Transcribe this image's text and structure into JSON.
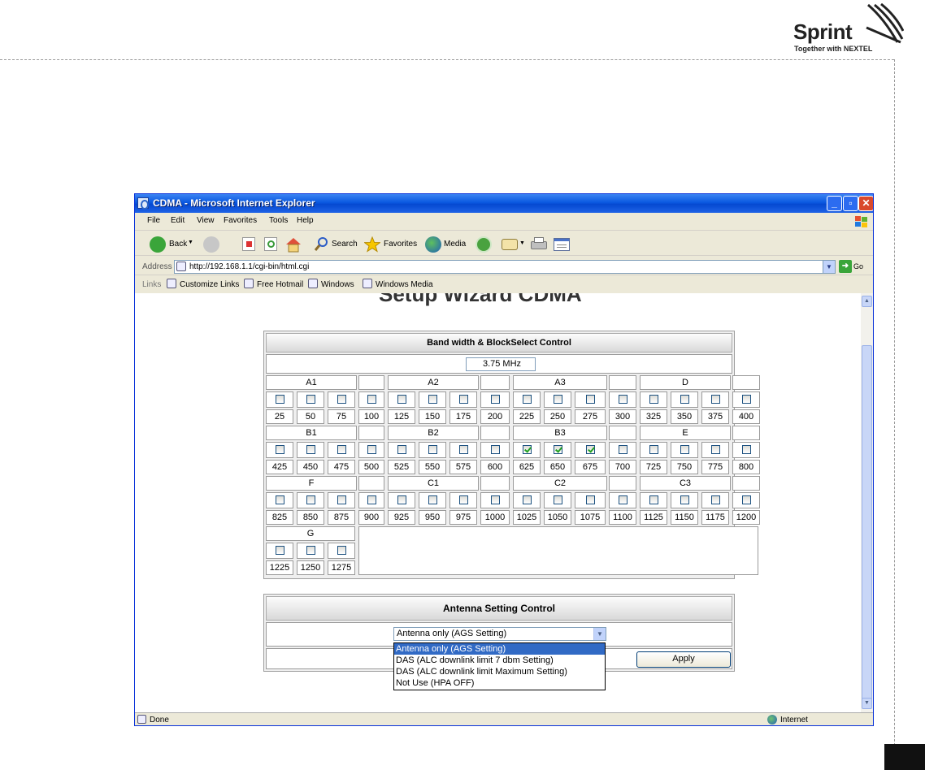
{
  "brand": {
    "name": "Sprint",
    "tagline": "Together with NEXTEL"
  },
  "window": {
    "title": "CDMA - Microsoft Internet Explorer"
  },
  "menu": [
    "File",
    "Edit",
    "View",
    "Favorites",
    "Tools",
    "Help"
  ],
  "toolbar": {
    "back": "Back",
    "search": "Search",
    "favorites": "Favorites",
    "media": "Media"
  },
  "address": {
    "label": "Address",
    "url": "http://192.168.1.1/cgi-bin/html.cgi",
    "go": "Go"
  },
  "links": {
    "label": "Links",
    "items": [
      "Customize Links",
      "Free Hotmail",
      "Windows",
      "Windows Media"
    ]
  },
  "page": {
    "title": "Setup Wizard CDMA"
  },
  "band_panel": {
    "title": "Band width & BlockSelect Control",
    "bandwidth": "3.75 MHz",
    "rows": [
      {
        "groups": [
          "A1",
          "A2",
          "A3",
          "D"
        ],
        "channels": [
          "25",
          "50",
          "75",
          "100",
          "125",
          "150",
          "175",
          "200",
          "225",
          "250",
          "275",
          "300",
          "325",
          "350",
          "375",
          "400"
        ],
        "checked": []
      },
      {
        "groups": [
          "B1",
          "B2",
          "B3",
          "E"
        ],
        "channels": [
          "425",
          "450",
          "475",
          "500",
          "525",
          "550",
          "575",
          "600",
          "625",
          "650",
          "675",
          "700",
          "725",
          "750",
          "775",
          "800"
        ],
        "checked": [
          8,
          9,
          10
        ]
      },
      {
        "groups": [
          "F",
          "C1",
          "C2",
          "C3"
        ],
        "channels": [
          "825",
          "850",
          "875",
          "900",
          "925",
          "950",
          "975",
          "1000",
          "1025",
          "1050",
          "1075",
          "1100",
          "1125",
          "1150",
          "1175",
          "1200"
        ],
        "checked": []
      }
    ],
    "last_row": {
      "group": "G",
      "channels": [
        "1225",
        "1250",
        "1275"
      ]
    }
  },
  "antenna_panel": {
    "title": "Antenna Setting Control",
    "selected": "Antenna only (AGS Setting)",
    "options": [
      "Antenna only (AGS Setting)",
      "DAS (ALC downlink limit 7 dbm Setting)",
      "DAS (ALC downlink limit Maximum Setting)",
      "Not Use (HPA OFF)"
    ],
    "apply_label": "Apply"
  },
  "status": {
    "left": "Done",
    "zone": "Internet"
  }
}
